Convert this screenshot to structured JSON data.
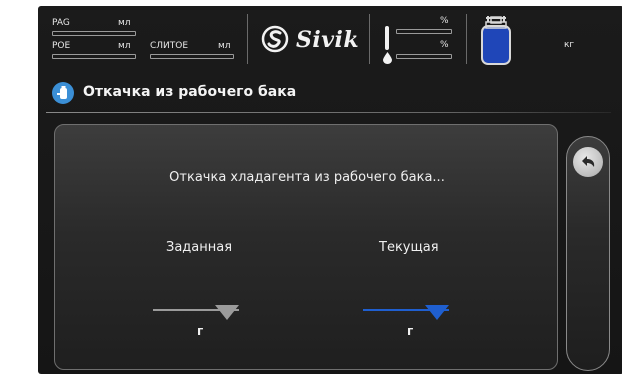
{
  "header": {
    "oil": {
      "pag": {
        "label": "PAG",
        "unit": "мл"
      },
      "poe": {
        "label": "POE",
        "unit": "мл"
      },
      "drain": {
        "label": "СЛИТОЕ",
        "unit": "мл"
      }
    },
    "brand": "Sivik",
    "temperature_unit": "%",
    "humidity_unit": "%",
    "tank_unit": "кг"
  },
  "page": {
    "title": "Откачка из рабочего бака",
    "status_message": "Откачка хладагента из рабочего бака...",
    "target": {
      "label": "Заданная",
      "unit": "г"
    },
    "current": {
      "label": "Текущая",
      "unit": "г"
    }
  },
  "icons": {
    "title": "refrigerant-recovery-icon",
    "back": "back-arrow-icon",
    "thermometer": "thermometer-icon",
    "drop": "water-drop-icon",
    "tank": "refrigerant-tank-icon",
    "logo": "sivik-logo-icon"
  },
  "colors": {
    "accent_blue": "#1f5fd0",
    "target_gray": "#9b9b9b",
    "title_icon_blue": "#3b8fd6",
    "tank_fill": "#1f46b8"
  }
}
